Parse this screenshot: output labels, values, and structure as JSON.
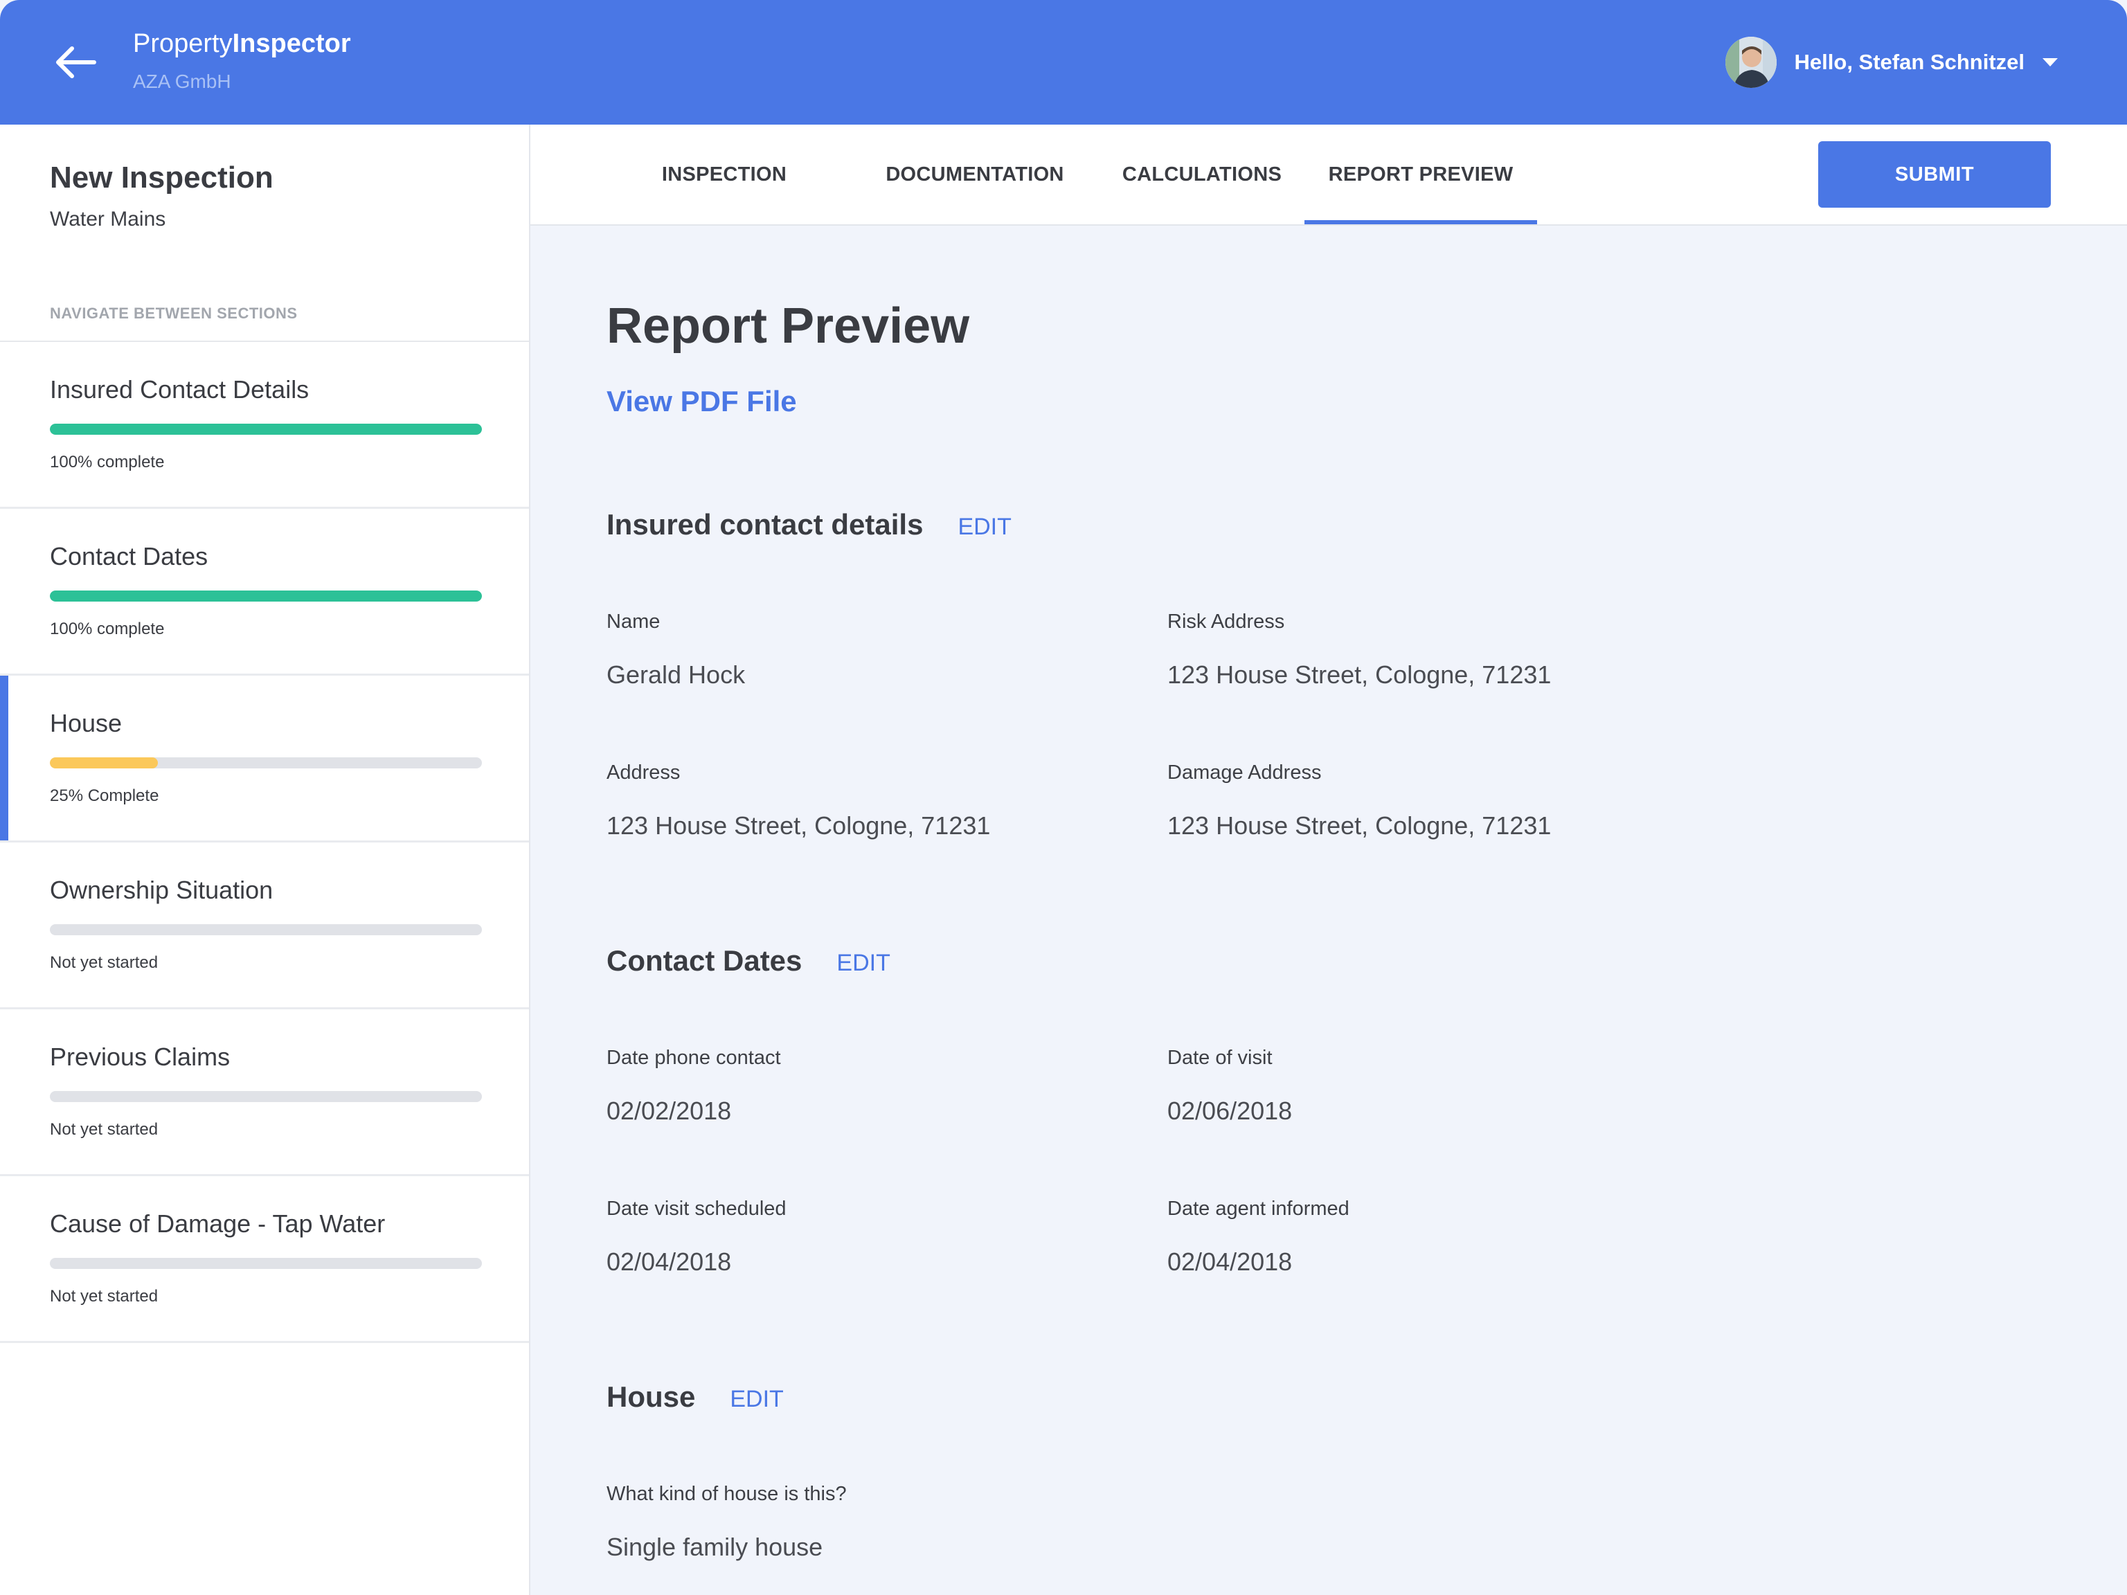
{
  "header": {
    "brand_light": "Property",
    "brand_bold": "Inspector",
    "company": "AZA GmbH",
    "greeting": "Hello, Stefan Schnitzel"
  },
  "sidebar": {
    "title": "New Inspection",
    "subtitle": "Water Mains",
    "nav_label": "NAVIGATE BETWEEN SECTIONS",
    "sections": [
      {
        "title": "Insured Contact Details",
        "status": "100% complete",
        "progress": 1.0,
        "color": "#2cc197"
      },
      {
        "title": "Contact Dates",
        "status": "100% complete",
        "progress": 1.0,
        "color": "#2cc197"
      },
      {
        "title": "House",
        "status": "25% Complete",
        "progress": 0.25,
        "color": "#fbc85a"
      },
      {
        "title": "Ownership Situation",
        "status": "Not yet started",
        "progress": 0,
        "color": "#e0e2e7"
      },
      {
        "title": "Previous Claims",
        "status": "Not yet started",
        "progress": 0,
        "color": "#e0e2e7"
      },
      {
        "title": "Cause of Damage - Tap Water",
        "status": "Not yet started",
        "progress": 0,
        "color": "#e0e2e7"
      }
    ]
  },
  "tabs": {
    "items": [
      "INSPECTION",
      "DOCUMENTATION",
      "CALCULATIONS",
      "REPORT PREVIEW"
    ],
    "active": "REPORT PREVIEW",
    "submit_label": "SUBMIT"
  },
  "main": {
    "title": "Report Preview",
    "pdf_link": "View PDF File",
    "edit_label": "EDIT",
    "insured": {
      "title": "Insured contact details",
      "name_label": "Name",
      "name_value": "Gerald Hock",
      "risk_label": "Risk Address",
      "risk_value": "123 House Street, Cologne, 71231",
      "address_label": "Address",
      "address_value": "123 House Street, Cologne, 71231",
      "damage_label": "Damage Address",
      "damage_value": "123 House Street, Cologne, 71231"
    },
    "dates": {
      "title": "Contact Dates",
      "phone_label": "Date phone contact",
      "phone_value": "02/02/2018",
      "visit_label": "Date of visit",
      "visit_value": "02/06/2018",
      "scheduled_label": "Date visit scheduled",
      "scheduled_value": "02/04/2018",
      "agent_label": "Date agent informed",
      "agent_value": "02/04/2018"
    },
    "house": {
      "title": "House",
      "kind_label": "What kind of house is this?",
      "kind_value": "Single family house"
    }
  },
  "colors": {
    "accent": "#4a77e5",
    "complete": "#2cc197",
    "partial": "#fbc85a",
    "empty": "#e0e2e7",
    "background": "#f1f4fb"
  }
}
